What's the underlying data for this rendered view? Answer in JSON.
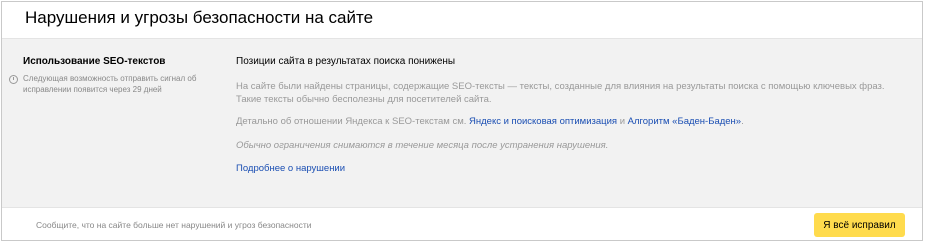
{
  "header": {
    "title": "Нарушения и угрозы безопасности на сайте"
  },
  "violation": {
    "name": "Использование SEO-текстов",
    "note": "Следующая возможность отправить сигнал об исправлении появится через 29 дней",
    "headline": "Позиции сайта в результатах поиска понижены",
    "description": "На сайте были найдены страницы, содержащие SEO-тексты — тексты, созданные для влияния на результаты поиска с помощью ключевых фраз. Такие тексты обычно бесполезны для посетителей сайта.",
    "details_prefix": "Детально об отношении Яндекса к SEO-текстам см.",
    "link1": "Яндекс и поисковая оптимизация",
    "details_and": "и",
    "link2": "Алгоритм «Баден-Баден»",
    "details_end": ".",
    "restriction_note": "Обычно ограничения снимаются в течение месяца после устранения нарушения.",
    "more_link": "Подробнее о нарушении"
  },
  "footer": {
    "text": "Сообщите, что на сайте больше нет нарушений и угроз безопасности",
    "button": "Я всё исправил"
  },
  "colors": {
    "button_bg": "#ffdb4d",
    "link": "#1b4fb3",
    "panel_bg": "#f2f2f2"
  }
}
